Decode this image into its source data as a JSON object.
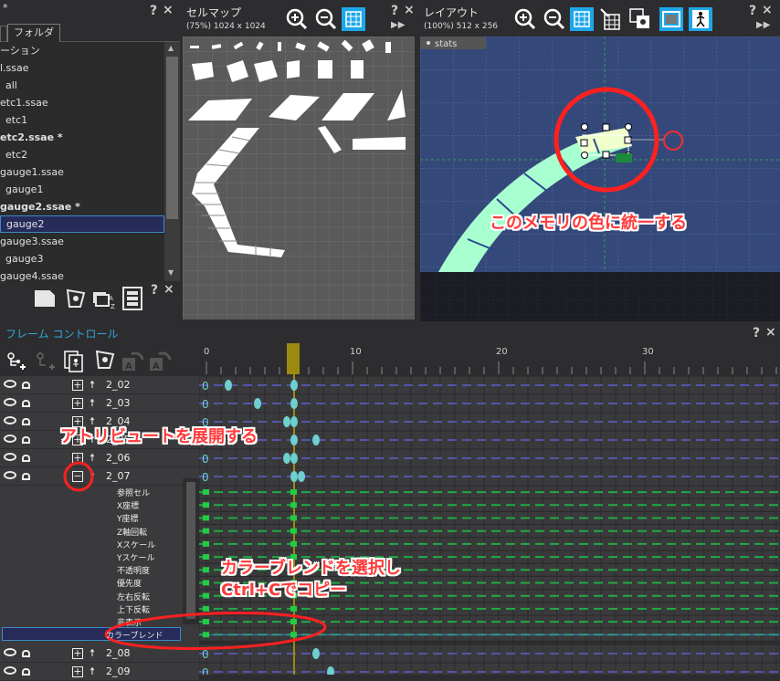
{
  "project_panel": {
    "tabs": [
      "フォルダ"
    ],
    "items": [
      {
        "label": "ーション",
        "style": "normal",
        "indent": 0
      },
      {
        "label": "l.ssae",
        "style": "normal",
        "indent": 0
      },
      {
        "label": "all",
        "style": "normal",
        "indent": 1
      },
      {
        "label": "etc1.ssae",
        "style": "normal",
        "indent": 0
      },
      {
        "label": "etc1",
        "style": "normal",
        "indent": 1
      },
      {
        "label": "etc2.ssae *",
        "style": "bold",
        "indent": 0
      },
      {
        "label": "etc2",
        "style": "normal",
        "indent": 1
      },
      {
        "label": "gauge1.ssae",
        "style": "normal",
        "indent": 0
      },
      {
        "label": "gauge1",
        "style": "normal",
        "indent": 1
      },
      {
        "label": "gauge2.ssae *",
        "style": "bold",
        "indent": 0
      },
      {
        "label": "gauge2",
        "style": "selected",
        "indent": 1
      },
      {
        "label": "gauge3.ssae",
        "style": "normal",
        "indent": 0
      },
      {
        "label": "gauge3",
        "style": "normal",
        "indent": 1
      },
      {
        "label": "gauge4.ssae",
        "style": "normal",
        "indent": 0
      }
    ],
    "close_glyph": "×",
    "help_glyph": "?"
  },
  "cellmap_panel": {
    "title": "セルマップ",
    "subtitle": "(75%) 1024 x 1024",
    "help": "?",
    "close": "×"
  },
  "layout_panel": {
    "title": "レイアウト",
    "subtitle": "(100%) 512 x 256",
    "help": "?",
    "close": "×",
    "stats_label": "stats"
  },
  "frame_control": {
    "title": "フレーム コントロール",
    "help": "?",
    "close": "×",
    "ruler": [
      "0",
      "10",
      "20",
      "30"
    ],
    "tracks": [
      {
        "name": "2_02",
        "expanded": false
      },
      {
        "name": "2_03",
        "expanded": false
      },
      {
        "name": "2_04",
        "expanded": false
      },
      {
        "name": "2_05",
        "expanded": false
      },
      {
        "name": "2_06",
        "expanded": false
      },
      {
        "name": "2_07",
        "expanded": true
      }
    ],
    "attributes": [
      "参照セル",
      "X座標",
      "Y座標",
      "Z軸回転",
      "Xスケール",
      "Yスケール",
      "不透明度",
      "優先度",
      "左右反転",
      "上下反転",
      "非表示",
      "カラーブレンド"
    ],
    "tracks_after": [
      {
        "name": "2_08"
      },
      {
        "name": "2_09"
      }
    ]
  },
  "annotations": {
    "memory_color": "このメモリの色に統一する",
    "expand_attr": "アトリビュートを展開する",
    "select_copy_line1": "カラーブレンドを選択し",
    "select_copy_line2": "Ctrl+Cでコピー"
  },
  "colors": {
    "accent": "#1ea7e8",
    "annotation": "#ff2a2a",
    "canvas_bg": "#34497a",
    "gauge_fill": "#a8ffd0",
    "timeline_key": "#6ecfcf",
    "green_key": "#22cc44"
  }
}
